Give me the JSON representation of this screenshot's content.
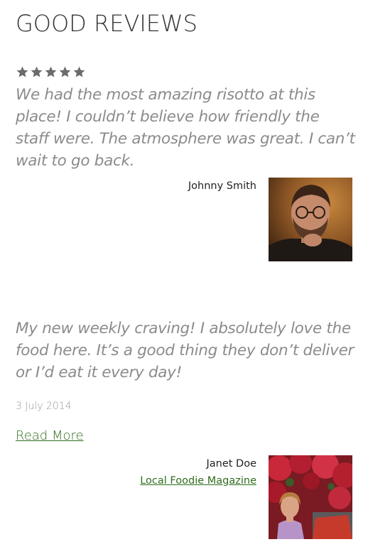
{
  "section": {
    "title": "GOOD REVIEWS"
  },
  "reviews": [
    {
      "rating": 5,
      "quote": "We had the most amazing risotto at this place! I couldn’t believe how friendly the staff were. The atmosphere was great. I can’t wait to go back.",
      "author": "Johnny Smith",
      "avatar_icon": "person-photo-man"
    },
    {
      "quote": "My new weekly craving! I absolutely love the food here. It’s a good thing they don’t deliver or I’d eat it every day!",
      "date": "3 July 2014",
      "read_more_label": "Read More",
      "author": "Janet Doe",
      "source": "Local Foodie Magazine",
      "avatar_icon": "person-photo-woman"
    }
  ],
  "colors": {
    "star": "#6b6b6b",
    "quote_text": "#8b8b8b",
    "link": "#2f6e1c"
  }
}
